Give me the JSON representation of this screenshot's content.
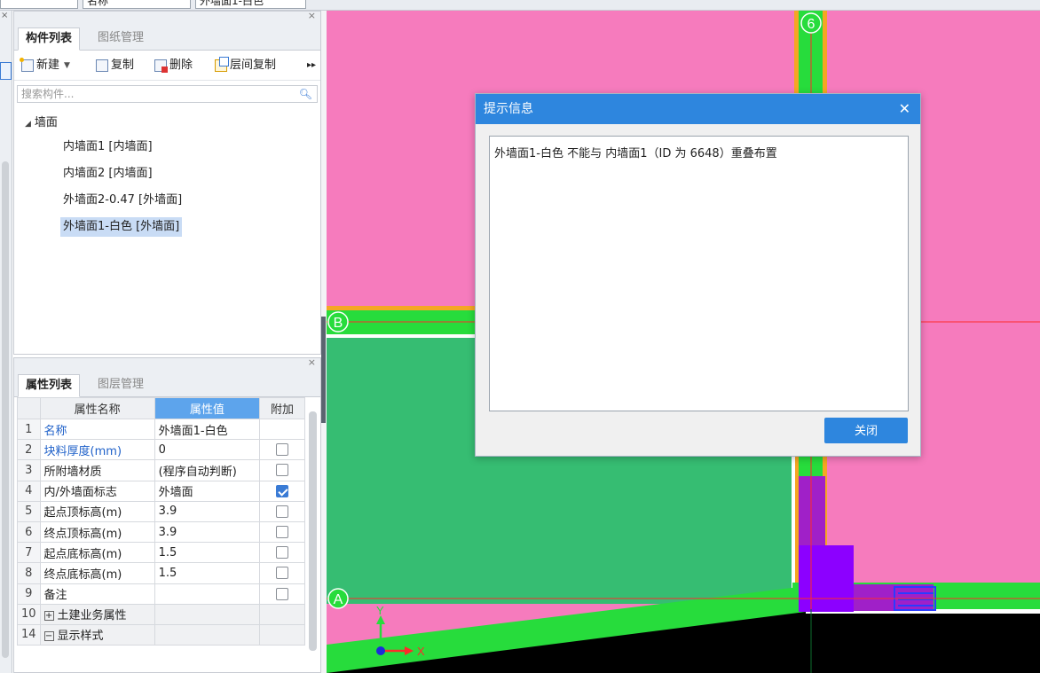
{
  "top": {
    "field2": "名称",
    "field3": "外墙面1-白色"
  },
  "component_panel": {
    "tabs": [
      "构件列表",
      "图纸管理"
    ],
    "toolbar": {
      "new": "新建",
      "copy": "复制",
      "delete": "删除",
      "floor_copy": "层间复制"
    },
    "search_placeholder": "搜索构件...",
    "tree_root": "墙面",
    "items": [
      "内墙面1 [内墙面]",
      "内墙面2 [内墙面]",
      "外墙面2-0.47 [外墙面]",
      "外墙面1-白色 [外墙面]"
    ],
    "selected_index": 3
  },
  "property_panel": {
    "tabs": [
      "属性列表",
      "图层管理"
    ],
    "headers": {
      "name": "属性名称",
      "value": "属性值",
      "extra": "附加"
    },
    "rows": [
      {
        "num": "1",
        "name": "名称",
        "value": "外墙面1-白色",
        "blue": true,
        "checkbox": null
      },
      {
        "num": "2",
        "name": "块料厚度(mm)",
        "value": "0",
        "blue": true,
        "checkbox": false
      },
      {
        "num": "3",
        "name": "所附墙材质",
        "value": "(程序自动判断)",
        "blue": false,
        "checkbox": false
      },
      {
        "num": "4",
        "name": "内/外墙面标志",
        "value": "外墙面",
        "blue": false,
        "checkbox": true
      },
      {
        "num": "5",
        "name": "起点顶标高(m)",
        "value": "3.9",
        "blue": false,
        "checkbox": false
      },
      {
        "num": "6",
        "name": "终点顶标高(m)",
        "value": "3.9",
        "blue": false,
        "checkbox": false
      },
      {
        "num": "7",
        "name": "起点底标高(m)",
        "value": "1.5",
        "blue": false,
        "checkbox": false
      },
      {
        "num": "8",
        "name": "终点底标高(m)",
        "value": "1.5",
        "blue": false,
        "checkbox": false
      },
      {
        "num": "9",
        "name": "备注",
        "value": "",
        "blue": false,
        "checkbox": false
      }
    ],
    "groups": [
      {
        "num": "10",
        "symbol": "+",
        "name": "土建业务属性"
      },
      {
        "num": "14",
        "symbol": "−",
        "name": "显示样式"
      }
    ]
  },
  "canvas": {
    "axis_labels": {
      "col_6": "6",
      "row_b": "B",
      "row_a": "A"
    },
    "coord_axes": {
      "x": "X",
      "y": "Y"
    },
    "colors": {
      "pink": "#f67bbd",
      "green": "#27dc3c",
      "dark_green": "#36bd72",
      "purple": "#8c00ff",
      "orange": "#f5a623",
      "red_line": "#ff2a2a"
    }
  },
  "dialog": {
    "title": "提示信息",
    "message": "外墙面1-白色 不能与 内墙面1（ID 为 6648）重叠布置",
    "close_button": "关闭"
  }
}
